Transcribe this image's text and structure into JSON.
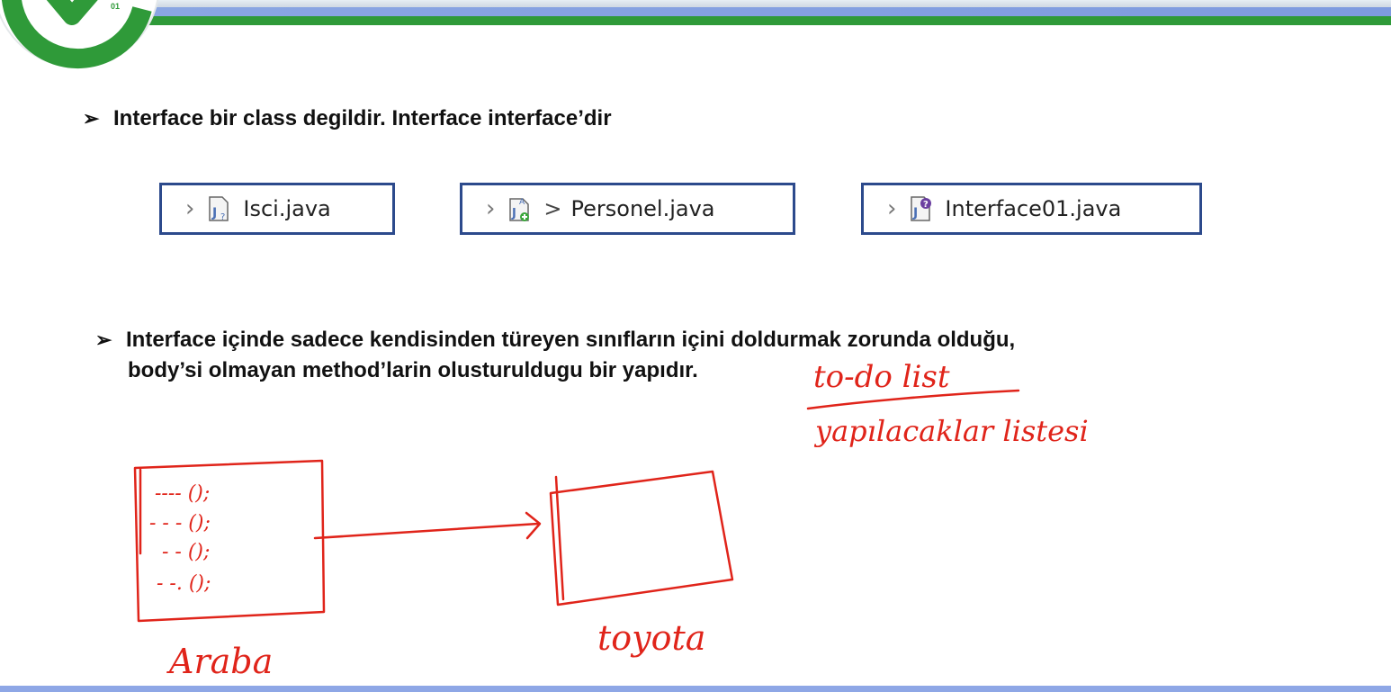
{
  "slide": {
    "logo_text": "01",
    "bullets": [
      {
        "text": "Interface bir class degildir. Interface interface’dir"
      },
      {
        "line1": "Interface içinde sadece kendisinden türeyen sınıfların içini doldurmak zorunda olduğu,",
        "line2": "body’si olmayan method’larin olusturuldugu bir yapıdır."
      }
    ],
    "files": [
      {
        "name": "Isci.java",
        "icon": "java-class-icon"
      },
      {
        "name": "Personel.java",
        "icon": "java-abstract-class-icon"
      },
      {
        "name": "Interface01.java",
        "icon": "java-interface-icon"
      }
    ]
  },
  "annotations": {
    "todo": "to-do list",
    "yapilacaklar": "yapılacaklar listesi",
    "left_box_lines": [
      "---- ();",
      "- - - ();",
      "- - ();",
      "- -. ();"
    ],
    "left_label": "Araba",
    "right_label": "toyota"
  },
  "colors": {
    "accent_green": "#2f9a39",
    "accent_blue": "#2c4a8c",
    "ink_red": "#e0241a"
  }
}
